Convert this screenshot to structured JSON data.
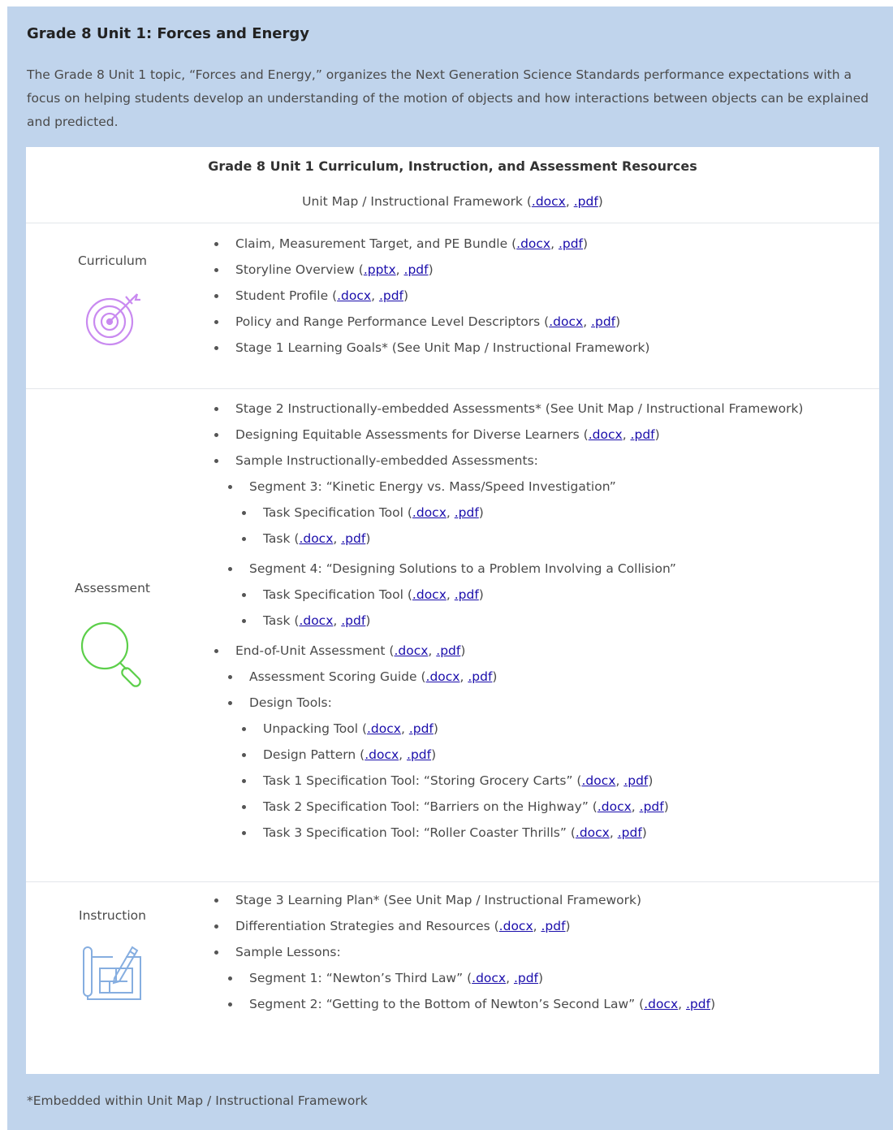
{
  "title": "Grade 8 Unit 1: Forces and Energy",
  "intro": "The Grade 8 Unit 1 topic, “Forces and Energy,” organizes the Next Generation Science Standards performance expectations with a focus on helping students develop an understanding of the motion of objects and how interactions between objects can be explained and predicted.",
  "table": {
    "heading": "Grade 8 Unit 1 Curriculum, Instruction, and Assessment Resources",
    "unit_map_text": "Unit Map / Instructional Framework",
    "link_docx": ".docx",
    "link_pdf": ".pdf",
    "link_pptx": ".pptx"
  },
  "sections": {
    "curriculum": {
      "label": "Curriculum",
      "icon": "target-icon",
      "icon_color": "#c98af0",
      "items": [
        "Claim, Measurement Target, and PE Bundle",
        "Storyline Overview",
        "Student Profile",
        "Policy and Range Performance Level Descriptors",
        "Stage 1 Learning Goals* (See Unit Map / Instructional Framework)"
      ]
    },
    "assessment": {
      "label": "Assessment",
      "icon": "magnifier-icon",
      "icon_color": "#5ccf4a",
      "items": [
        "Stage 2 Instructionally-embedded Assessments* (See Unit Map / Instructional Framework)",
        "Designing Equitable Assessments for Diverse Learners",
        "Sample Instructionally-embedded Assessments:",
        "Segment 3: “Kinetic Energy vs. Mass/Speed Investigation”",
        "Task Specification Tool",
        "Task",
        "Segment 4: “Designing Solutions to a Problem Involving a Collision”",
        "Task Specification Tool",
        "Task",
        "End-of-Unit Assessment",
        "Assessment Scoring Guide",
        "Design Tools:",
        "Unpacking Tool",
        "Design Pattern",
        "Task 1 Specification Tool: “Storing Grocery Carts”",
        "Task 2 Specification Tool: “Barriers on the Highway”",
        "Task 3 Specification Tool: “Roller Coaster Thrills”"
      ]
    },
    "instruction": {
      "label": "Instruction",
      "icon": "blueprint-icon",
      "icon_color": "#86aee0",
      "items": [
        "Stage 3 Learning Plan* (See Unit Map / Instructional Framework)",
        "Differentiation Strategies and Resources",
        "Sample Lessons:",
        "Segment 1: “Newton’s Third Law”",
        "Segment 2: “Getting to the Bottom of Newton’s Second Law”"
      ]
    }
  },
  "footnote": "*Embedded within Unit Map / Instructional Framework"
}
